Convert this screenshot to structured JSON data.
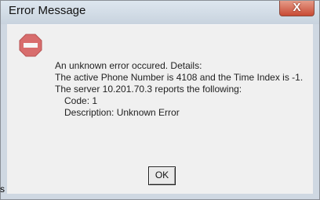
{
  "window": {
    "title": "Error Message",
    "close_label": "X"
  },
  "dialog": {
    "icon": "stop-icon",
    "lines": [
      "An unknown error occured. Details:",
      "The active Phone Number is 4108 and the Time Index is -1.",
      "The server 10.201.70.3 reports the following:",
      "Code: 1",
      "Description: Unknown Error"
    ],
    "ok_label": "OK"
  },
  "edge_text": "s",
  "colors": {
    "frame": "#cfd8e2",
    "client": "#f0f0f0",
    "stop_icon": "#d86d6d",
    "close_button": "#c84a34"
  }
}
